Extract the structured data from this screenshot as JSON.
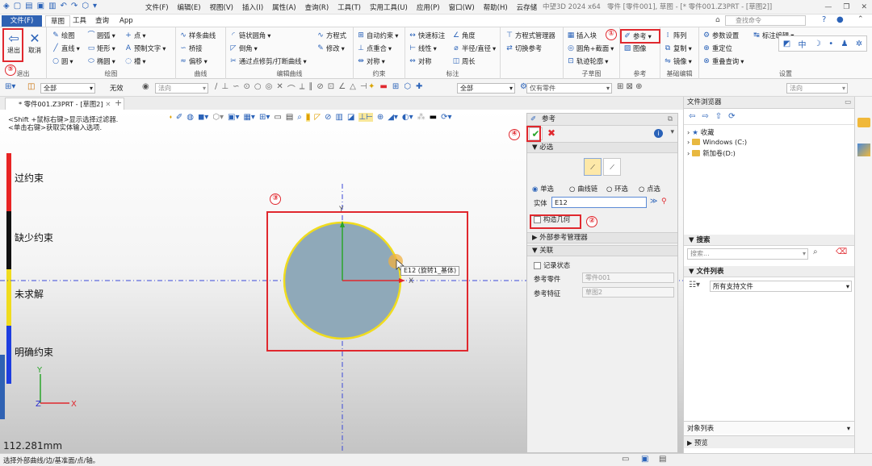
{
  "titlebar": {
    "menus": [
      "文件(F)",
      "编辑(E)",
      "视图(V)",
      "插入(I)",
      "属性(A)",
      "查询(R)",
      "工具(T)",
      "实用工具(U)",
      "应用(P)",
      "窗口(W)",
      "帮助(H)",
      "云存储"
    ],
    "app": "中望3D 2024 x64",
    "title": "零件 [零件001], 草图 - [* 零件001.Z3PRT - [草图2]]"
  },
  "tabs": {
    "file": "文件(F)",
    "sketch": "草图",
    "tool": "工具",
    "query": "查询",
    "app": "App"
  },
  "search_placeholder": "查找命令",
  "ribbon": {
    "exit": "退出",
    "cancel": "取消",
    "exit_group": "退出",
    "draw": {
      "items": [
        "绘图",
        "直线",
        "圆",
        "圆弧",
        "矩形",
        "椭圆",
        "点",
        "预制文字",
        "槽"
      ],
      "name": "绘图"
    },
    "curve": {
      "items": [
        "样条曲线",
        "桥接",
        "偏移"
      ],
      "name": "曲线"
    },
    "edit": {
      "items": [
        "链状圆角",
        "倒角",
        "通过点修剪/打断曲线",
        "方程式",
        "修改"
      ],
      "name": "编辑曲线"
    },
    "constraint": {
      "items": [
        "自动约束",
        "点重合",
        "对称"
      ],
      "name": "约束"
    },
    "dim": {
      "items": [
        "快速标注",
        "线性",
        "对称",
        "角度",
        "半径/直径",
        "周长"
      ],
      "name": "标注"
    },
    "sub": {
      "items": [
        "方程式管理器",
        "切换参考",
        "插入块",
        "圆角+截面",
        "轨迹轮廓"
      ],
      "name": "子草图"
    },
    "ref": {
      "items": [
        "参考",
        "图像"
      ],
      "name": "参考"
    },
    "basic": {
      "items": [
        "阵列",
        "复制",
        "镜像"
      ],
      "name": "基础编辑"
    },
    "settings": {
      "items": [
        "参数设置",
        "标注编辑",
        "重定位",
        "重叠查询"
      ],
      "name": "设置"
    }
  },
  "filterbar": {
    "combo1": "全部",
    "none": "无效",
    "normal": "法向",
    "combo2": "全部",
    "parts": "仅有零件",
    "normal2": "法向"
  },
  "doctab": "* 零件001.Z3PRT - [草图2]",
  "hints": [
    "<Shift +鼠标右键>显示选择过滤器.",
    "<单击右键>获取实体输入选项."
  ],
  "legend": [
    {
      "label": "过约束",
      "color": "#e82424"
    },
    {
      "label": "缺少约束",
      "color": "#111111"
    },
    {
      "label": "未求解",
      "color": "#f0dc1e"
    },
    {
      "label": "明确约束",
      "color": "#1e3ee0"
    }
  ],
  "tooltip": "E12 (旋转1_基体)",
  "coord_readout": "112.281mm",
  "dialog": {
    "title": "参考",
    "required": "必选",
    "radios": [
      "单选",
      "曲线链",
      "环选",
      "点选"
    ],
    "entity_label": "实体",
    "entity_value": "E12",
    "construct": "构造几何",
    "external_ref": "外部参考管理器",
    "assoc": "关联",
    "record": "记录状态",
    "ref_part_label": "参考零件",
    "ref_part_value": "零件001",
    "ref_feat_label": "参考特征",
    "ref_feat_value": "草图2"
  },
  "browser": {
    "title": "文件浏览器",
    "tree": [
      "收藏",
      "Windows (C:)",
      "新加卷(D:)"
    ],
    "search_section": "搜索",
    "search_placeholder": "搜索...",
    "files_section": "文件列表",
    "file_filter": "所有支持文件",
    "object_list": "对象列表",
    "preview": "预览"
  },
  "callouts": [
    "①",
    "②",
    "③",
    "④",
    "⑤"
  ],
  "status": "选择外部曲线/边/基准面/点/轴。",
  "colors": {
    "accent": "#2f62b3",
    "callout": "#e0282e",
    "circle_fill": "#8fa9b9",
    "circle_edge": "#f0dc1e"
  }
}
